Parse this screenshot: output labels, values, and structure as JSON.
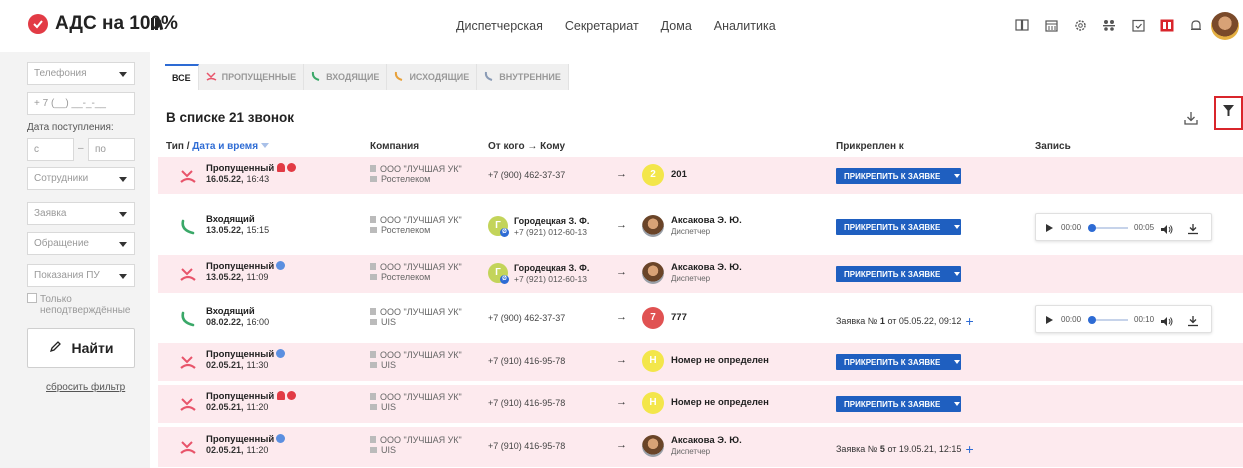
{
  "app": {
    "title": "АДС на 100%"
  },
  "nav": [
    "Диспетчерская",
    "Секретариат",
    "Дома",
    "Аналитика"
  ],
  "header_icons": [
    "book-icon",
    "calendar-icon",
    "gear-icon",
    "users-icon",
    "checklist-icon",
    "report-icon",
    "bell-icon"
  ],
  "sidebar": {
    "telephony": "Телефония",
    "phone_placeholder": "+ 7 (__) __-_-__",
    "date_label": "Дата поступления:",
    "date_from": "с",
    "date_dash": "–",
    "date_to": "по",
    "employees": "Сотрудники",
    "request": "Заявка",
    "appeal": "Обращение",
    "meter": "Показания ПУ",
    "unconfirmed": "Только неподтверждённые",
    "find": "Найти",
    "reset": "сбросить фильтр"
  },
  "tabs": [
    "ВСЕ",
    "ПРОПУЩЕННЫЕ",
    "ВХОДЯЩИЕ",
    "ИСХОДЯЩИЕ",
    "ВНУТРЕННИЕ"
  ],
  "list": {
    "title": "В списке 21 звонок"
  },
  "columns": {
    "type": "Тип /",
    "datetime": "Дата и время",
    "company": "Компания",
    "from": "От кого",
    "to_arrow": "→",
    "to": "Кому",
    "attached": "Прикреплен к",
    "record": "Запись"
  },
  "attach_label": "ПРИКРЕПИТЬ К ЗАЯВКЕ",
  "rows": [
    {
      "kind": "missed",
      "type": "Пропущенный",
      "date": "16.05.22,",
      "time": "16:43",
      "company": "ООО \"ЛУЧШАЯ УК\"",
      "provider": "Ростелеком",
      "from_phone": "+7 (900) 462-37-37",
      "to_avatar": "2",
      "to_color": "#f3e64a",
      "to_name": "201",
      "action": "attach",
      "bell": true,
      "mark": "red"
    },
    {
      "kind": "incoming",
      "type": "Входящий",
      "date": "13.05.22,",
      "time": "15:15",
      "company": "ООО \"ЛУЧШАЯ УК\"",
      "provider": "Ростелеком",
      "from_name": "Городецкая З. Ф.",
      "from_phone2": "+7 (921) 012-60-13",
      "to_name": "Аксакова Э. Ю.",
      "to_sub": "Диспетчер",
      "action": "attach",
      "player": {
        "t1": "00:00",
        "t2": "00:05"
      }
    },
    {
      "kind": "missed",
      "type": "Пропущенный",
      "date": "13.05.22,",
      "time": "11:09",
      "company": "ООО \"ЛУЧШАЯ УК\"",
      "provider": "Ростелеком",
      "from_name": "Городецкая З. Ф.",
      "from_phone2": "+7 (921) 012-60-13",
      "to_name": "Аксакова Э. Ю.",
      "to_sub": "Диспетчер",
      "action": "attach",
      "mark": "blue"
    },
    {
      "kind": "incoming",
      "type": "Входящий",
      "date": "08.02.22,",
      "time": "16:00",
      "company": "ООО \"ЛУЧШАЯ УК\"",
      "provider": "UIS",
      "from_phone": "+7 (900) 462-37-37",
      "to_avatar": "7",
      "to_color": "#e05252",
      "to_name": "777",
      "action": "ticket",
      "ticket": {
        "prefix": "Заявка №",
        "num": "1",
        "rest": "от 05.05.22, 09:12"
      },
      "player": {
        "t1": "00:00",
        "t2": "00:10"
      }
    },
    {
      "kind": "missed",
      "type": "Пропущенный",
      "date": "02.05.21,",
      "time": "11:30",
      "company": "ООО \"ЛУЧШАЯ УК\"",
      "provider": "UIS",
      "from_phone": "+7 (910) 416-95-78",
      "to_avatar": "Н",
      "to_color": "#f3e64a",
      "to_name": "Номер не определен",
      "action": "attach",
      "mark": "blue"
    },
    {
      "kind": "missed",
      "type": "Пропущенный",
      "date": "02.05.21,",
      "time": "11:20",
      "company": "ООО \"ЛУЧШАЯ УК\"",
      "provider": "UIS",
      "from_phone": "+7 (910) 416-95-78",
      "to_avatar": "Н",
      "to_color": "#f3e64a",
      "to_name": "Номер не определен",
      "action": "attach",
      "bell": true,
      "mark": "red"
    },
    {
      "kind": "missed",
      "type": "Пропущенный",
      "date": "02.05.21,",
      "time": "11:20",
      "company": "ООО \"ЛУЧШАЯ УК\"",
      "provider": "UIS",
      "from_phone": "+7 (910) 416-95-78",
      "to_name": "Аксакова Э. Ю.",
      "to_sub": "Диспетчер",
      "action": "ticket",
      "ticket": {
        "prefix": "Заявка №",
        "num": "5",
        "rest": "от 19.05.21, 12:15"
      },
      "mark": "blue"
    }
  ],
  "colors": {
    "accent": "#2d6bd4",
    "missed_row": "#fdeaee",
    "brand_red": "#e23b45",
    "attach_button": "#1f5fc0"
  }
}
